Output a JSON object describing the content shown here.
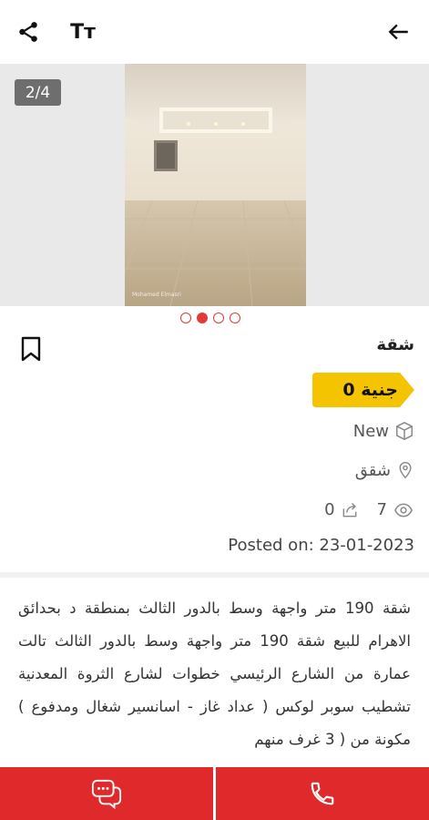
{
  "toolbar": {
    "text_size_label": "Tт"
  },
  "gallery": {
    "counter": "2/4",
    "dots_total": 4,
    "dots_active": 1,
    "watermark": "Mohamed Elmasri"
  },
  "listing": {
    "title": "شقة",
    "price": "جنية 0",
    "condition": "New",
    "location": "شقق",
    "views": "7",
    "shares": "0",
    "posted": "Posted on: 23-01-2023",
    "description": "شقة 190 متر واجهة وسط بالدور الثالث بمنطقة د بحدائق الاهرام للبيع شقة 190 متر واجهة وسط بالدور الثالث تالت عمارة من الشارع الرئيسي خطوات لشارع الثروة المعدنية تشطيب سوبر لوكس ( عداد غاز - اسانسير شغال ومدفوع ) مكونة من ( 3 غرف منهم"
  },
  "colors": {
    "accent": "#e0292b",
    "price_tag": "#f5c400"
  }
}
